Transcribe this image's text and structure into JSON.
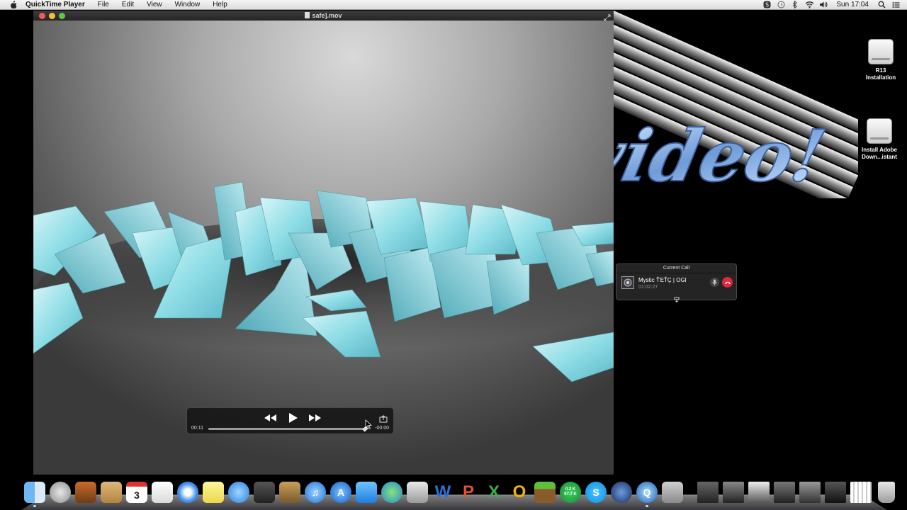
{
  "menubar": {
    "app_name": "QuickTime Player",
    "menus": [
      "File",
      "Edit",
      "View",
      "Window",
      "Help"
    ],
    "clock": "Sun 17:04"
  },
  "window": {
    "title": "safe].mov"
  },
  "player": {
    "elapsed": "00:11",
    "remaining": "-00:00",
    "progress": 0.98
  },
  "desktop_icons": [
    {
      "label_line1": "R13",
      "label_line2": "Installation"
    },
    {
      "label_line1": "Install Adobe",
      "label_line2": "Down...istant"
    }
  ],
  "call": {
    "header": "Current Call",
    "caller": "Mystic ŤΈŤÇ | OGl",
    "duration": "01:02:27"
  },
  "dock": {
    "activity_up": "0.2 K",
    "activity_down": "97.7 K",
    "calendar_day": "3"
  },
  "colors": {
    "hangup_red": "#e0283c",
    "ice_cyan": "#9fe3ea"
  }
}
